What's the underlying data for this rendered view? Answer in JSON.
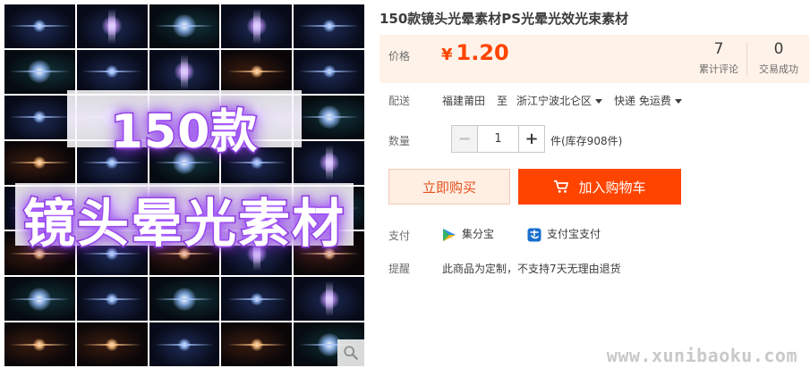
{
  "gallery": {
    "poster_line1": "150款",
    "poster_line2": "镜头晕光素材",
    "zoom_icon": "magnifier-icon"
  },
  "product": {
    "title": "150款镜头光晕素材PS光晕光效光束素材"
  },
  "price": {
    "label": "价格",
    "currency": "¥",
    "value": "1.20",
    "color": "#ff4400"
  },
  "stats": {
    "reviews_count": "7",
    "reviews_label": "累计评论",
    "deals_count": "0",
    "deals_label": "交易成功"
  },
  "delivery": {
    "label": "配送",
    "from": "福建莆田",
    "to_word": "至",
    "to": "浙江宁波北仑区",
    "shipping": "快递 免运费"
  },
  "quantity": {
    "label": "数量",
    "minus": "−",
    "value": "1",
    "plus": "+",
    "stock": "件(库存908件)"
  },
  "actions": {
    "buy_now": "立即购买",
    "add_to_cart": "加入购物车",
    "cart_icon": "cart-icon"
  },
  "payment": {
    "label": "支付",
    "method1": "集分宝",
    "method2": "支付宝支付"
  },
  "notice": {
    "label": "提醒",
    "text": "此商品为定制，不支持7天无理由退货"
  },
  "watermark": "www.xunibaoku.com",
  "colors": {
    "accent": "#ff4400",
    "price_bg": "#fff2e8",
    "buy_bg": "#ffeee2",
    "glow": "#9a45ff"
  }
}
